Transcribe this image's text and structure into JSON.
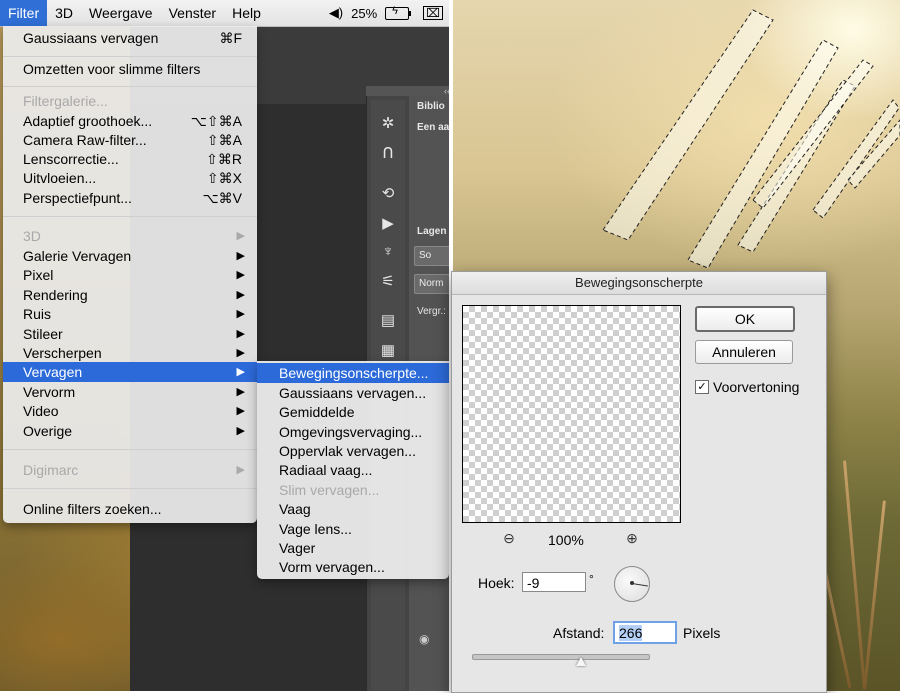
{
  "menubar": {
    "items": [
      "Filter",
      "3D",
      "Weergave",
      "Venster",
      "Help"
    ],
    "active": "Filter",
    "battery": "25%"
  },
  "filter_menu": {
    "rows": [
      {
        "label": "Gaussiaans vervagen",
        "shortcut": "⌘F"
      },
      {
        "label": "Omzetten voor slimme filters"
      },
      {
        "label": "Filtergalerie...",
        "disabled": true
      },
      {
        "label": "Adaptief groothoek...",
        "shortcut": "⌥⇧⌘A"
      },
      {
        "label": "Camera Raw-filter...",
        "shortcut": "⇧⌘A"
      },
      {
        "label": "Lenscorrectie...",
        "shortcut": "⇧⌘R"
      },
      {
        "label": "Uitvloeien...",
        "shortcut": "⇧⌘X"
      },
      {
        "label": "Perspectiefpunt...",
        "shortcut": "⌥⌘V"
      },
      {
        "label": "3D",
        "disabled": true,
        "submenu": true
      },
      {
        "label": "Galerie Vervagen",
        "submenu": true
      },
      {
        "label": "Pixel",
        "submenu": true
      },
      {
        "label": "Rendering",
        "submenu": true
      },
      {
        "label": "Ruis",
        "submenu": true
      },
      {
        "label": "Stileer",
        "submenu": true
      },
      {
        "label": "Verscherpen",
        "submenu": true
      },
      {
        "label": "Vervagen",
        "submenu": true,
        "highlighted": true
      },
      {
        "label": "Vervorm",
        "submenu": true
      },
      {
        "label": "Video",
        "submenu": true
      },
      {
        "label": "Overige",
        "submenu": true
      },
      {
        "label": "Digimarc",
        "disabled": true,
        "submenu": true
      },
      {
        "label": "Online filters zoeken..."
      }
    ]
  },
  "vervagen_submenu": {
    "items": [
      {
        "label": "Bewegingsonscherpte...",
        "highlighted": true
      },
      {
        "label": "Gaussiaans vervagen..."
      },
      {
        "label": "Gemiddelde"
      },
      {
        "label": "Omgevingsvervaging..."
      },
      {
        "label": "Oppervlak vervagen..."
      },
      {
        "label": "Radiaal vaag..."
      },
      {
        "label": "Slim vervagen...",
        "disabled": true
      },
      {
        "label": "Vaag"
      },
      {
        "label": "Vage lens..."
      },
      {
        "label": "Vager"
      },
      {
        "label": "Vorm vervagen..."
      }
    ]
  },
  "ps_side": {
    "collapse": "‹‹",
    "bibliotheek": "Biblio",
    "een_aa": "Een aa",
    "lagen": "Lagen",
    "so_btn": "So",
    "norm_btn": "Norm",
    "vergr": "Vergr.:"
  },
  "dialog": {
    "title": "Bewegingsonscherpte",
    "ok_label": "OK",
    "cancel_label": "Annuleren",
    "preview_checkbox": {
      "label": "Voorvertoning",
      "checked": true
    },
    "zoom": "100%",
    "angle_label": "Hoek:",
    "angle_value": "-9",
    "degree_symbol": "°",
    "distance_label": "Afstand:",
    "distance_value": "266",
    "distance_unit": "Pixels",
    "slider_fraction": 0.62
  },
  "colors": {
    "menu_highlight": "#2c6ad9",
    "menubar_active": "#2f6fd6"
  },
  "icons": {
    "zoom_out": "zoom-out-icon",
    "zoom_in": "zoom-in-icon",
    "volume": "volume-icon",
    "battery": "battery-icon",
    "screen": "screen-icon"
  }
}
